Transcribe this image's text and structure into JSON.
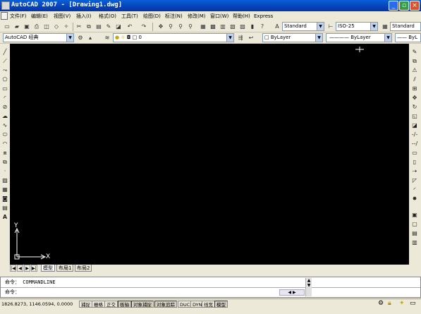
{
  "window": {
    "title": "AutoCAD 2007 - [Drawing1.dwg]"
  },
  "menu": [
    {
      "label": "文件(F)"
    },
    {
      "label": "编辑(E)"
    },
    {
      "label": "视图(V)"
    },
    {
      "label": "插入(I)"
    },
    {
      "label": "格式(O)"
    },
    {
      "label": "工具(T)"
    },
    {
      "label": "绘图(D)"
    },
    {
      "label": "标注(N)"
    },
    {
      "label": "修改(M)"
    },
    {
      "label": "窗口(W)"
    },
    {
      "label": "帮助(H)"
    },
    {
      "label": "Express"
    }
  ],
  "styles": {
    "text_style": "Standard",
    "dim_style": "ISO-25",
    "table_style": "Standard"
  },
  "workspace": "AutoCAD 经典",
  "layer": {
    "current": "0"
  },
  "properties": {
    "color": "ByLayer",
    "linetype": "ByLayer",
    "lineweight": "ByL"
  },
  "ucs": {
    "x_label": "X",
    "y_label": "Y"
  },
  "tabs": [
    {
      "label": "模型",
      "active": true
    },
    {
      "label": "布局1"
    },
    {
      "label": "布局2"
    }
  ],
  "command": {
    "line1_prompt": "命令：",
    "line1_text": "COMMANDLINE",
    "line2_prompt": "命令："
  },
  "status": {
    "coords": "1826.8273, 1146.0594, 0.0000",
    "toggles": [
      "捕捉",
      "栅格",
      "正交",
      "极轴",
      "对象捕捉",
      "对象追踪",
      "DUCS",
      "DYN",
      "线宽",
      "模型"
    ]
  },
  "colors": {
    "canvas": "#000000",
    "titlebar": "#0a5fd8",
    "chrome": "#ece9d8"
  }
}
